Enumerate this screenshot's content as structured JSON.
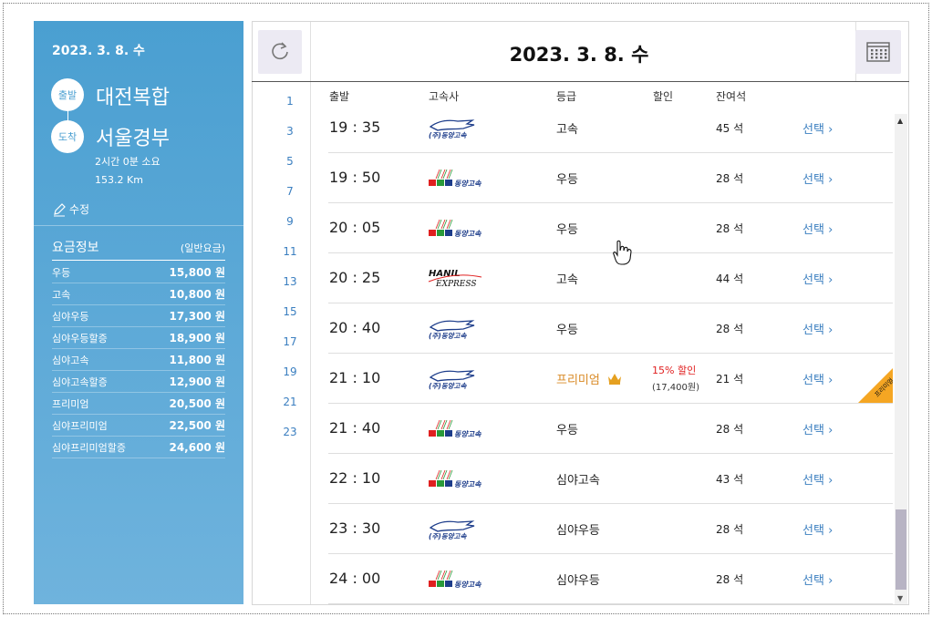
{
  "sidebar": {
    "date": "2023. 3. 8. 수",
    "departure_label": "출발",
    "departure_place": "대전복합",
    "arrival_label": "도착",
    "arrival_place": "서울경부",
    "duration": "2시간 0분 소요",
    "distance": "153.2 Km",
    "edit_label": "수정",
    "fare_title": "요금정보",
    "fare_subtitle": "(일반요금)",
    "fares": [
      {
        "name": "우등",
        "price": "15,800 원"
      },
      {
        "name": "고속",
        "price": "10,800 원"
      },
      {
        "name": "심야우등",
        "price": "17,300 원"
      },
      {
        "name": "심야우등할증",
        "price": "18,900 원"
      },
      {
        "name": "심야고속",
        "price": "11,800 원"
      },
      {
        "name": "심야고속할증",
        "price": "12,900 원"
      },
      {
        "name": "프리미엄",
        "price": "20,500 원"
      },
      {
        "name": "심야프리미엄",
        "price": "22,500 원"
      },
      {
        "name": "심야프리미엄할증",
        "price": "24,600 원"
      }
    ]
  },
  "header": {
    "date": "2023. 3. 8. 수"
  },
  "hours": [
    "1",
    "3",
    "5",
    "7",
    "9",
    "11",
    "13",
    "15",
    "17",
    "19",
    "21",
    "23"
  ],
  "columns": {
    "departure": "출발",
    "company": "고속사",
    "grade": "등급",
    "discount": "할인",
    "seats": "잔여석"
  },
  "rows": [
    {
      "time": "19 : 35",
      "company": "dongyang-a",
      "grade": "고속",
      "seats": "45 석",
      "select": "선택"
    },
    {
      "time": "19 : 50",
      "company": "dongyang-b",
      "grade": "우등",
      "seats": "28 석",
      "select": "선택"
    },
    {
      "time": "20 : 05",
      "company": "dongyang-b",
      "grade": "우등",
      "seats": "28 석",
      "select": "선택"
    },
    {
      "time": "20 : 25",
      "company": "hanil",
      "grade": "고속",
      "seats": "44 석",
      "select": "선택"
    },
    {
      "time": "20 : 40",
      "company": "dongyang-a",
      "grade": "우등",
      "seats": "28 석",
      "select": "선택"
    },
    {
      "time": "21 : 10",
      "company": "dongyang-a",
      "grade": "프리미엄",
      "discount": "15% 할인",
      "discount_price": "(17,400원)",
      "seats": "21 석",
      "select": "선택",
      "badge": "프리미엄"
    },
    {
      "time": "21 : 40",
      "company": "dongyang-b",
      "grade": "우등",
      "seats": "28 석",
      "select": "선택"
    },
    {
      "time": "22 : 10",
      "company": "dongyang-b",
      "grade": "심야고속",
      "seats": "43 석",
      "select": "선택"
    },
    {
      "time": "23 : 30",
      "company": "dongyang-a",
      "grade": "심야우등",
      "seats": "28 석",
      "select": "선택"
    },
    {
      "time": "24 : 00",
      "company": "dongyang-b",
      "grade": "심야우등",
      "seats": "28 석",
      "select": "선택"
    }
  ],
  "logo_text": {
    "dongyang": "동양고속",
    "dongyang_a": "(주)동양고속",
    "hanil_top": "HANIL",
    "hanil_bottom": "EXPRESS"
  },
  "colors": {
    "accent": "#3b7fc0",
    "sidebar": "#4a9fd1",
    "premium": "#d98a25",
    "discount": "#e02020",
    "badge": "#f5a623"
  }
}
